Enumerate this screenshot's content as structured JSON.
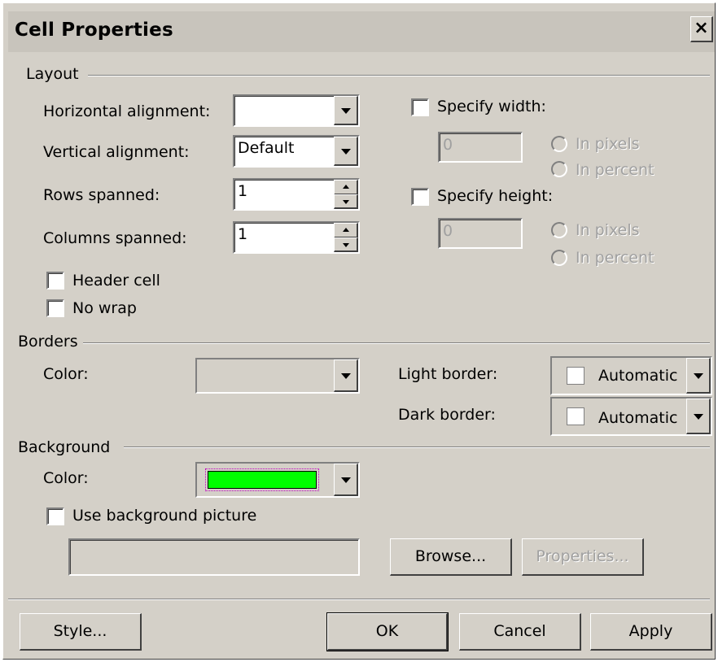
{
  "dialog": {
    "title": "Cell Properties",
    "close_symbol": "×"
  },
  "layout": {
    "group_label": "Layout",
    "horizontal_alignment": {
      "label": "Horizontal alignment:",
      "value": ""
    },
    "vertical_alignment": {
      "label": "Vertical alignment:",
      "value": "Default"
    },
    "rows_spanned": {
      "label": "Rows spanned:",
      "value": "1"
    },
    "columns_spanned": {
      "label": "Columns spanned:",
      "value": "1"
    },
    "header_cell": {
      "label": "Header cell",
      "checked": false
    },
    "no_wrap": {
      "label": "No wrap",
      "checked": false
    },
    "specify_width": {
      "label": "Specify width:",
      "checked": false,
      "value": "0",
      "option_pixels": "In pixels",
      "option_percent": "In percent"
    },
    "specify_height": {
      "label": "Specify height:",
      "checked": false,
      "value": "0",
      "option_pixels": "In pixels",
      "option_percent": "In percent"
    }
  },
  "borders": {
    "group_label": "Borders",
    "color_label": "Color:",
    "light_border": {
      "label": "Light border:",
      "value": "Automatic"
    },
    "dark_border": {
      "label": "Dark border:",
      "value": "Automatic"
    }
  },
  "background": {
    "group_label": "Background",
    "color_label": "Color:",
    "color_value": "#00ff00",
    "use_picture": {
      "label": "Use background picture",
      "checked": false
    },
    "picture_path": "",
    "browse_label": "Browse...",
    "properties_label": "Properties..."
  },
  "footer": {
    "style_label": "Style...",
    "ok_label": "OK",
    "cancel_label": "Cancel",
    "apply_label": "Apply"
  }
}
